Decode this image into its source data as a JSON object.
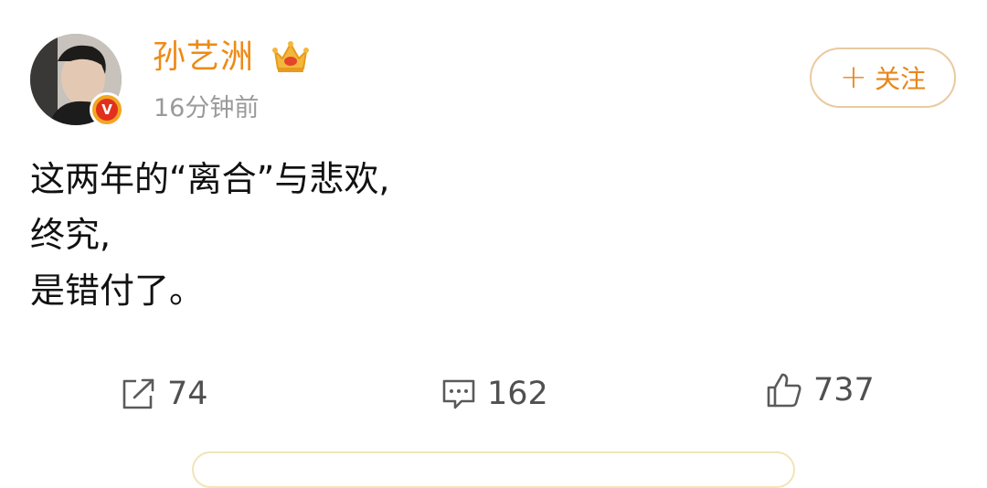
{
  "post": {
    "author": {
      "name": "孙艺洲",
      "avatar_icon": "avatar-photo",
      "verified_icon": "verified-v-icon",
      "verified_letter": "V",
      "rank_icon": "crown-icon"
    },
    "timestamp": "16分钟前",
    "follow_button": {
      "label": "关注",
      "icon": "plus-icon",
      "icon_glyph": "+"
    },
    "content_lines": [
      "这两年的“离合”与悲欢,",
      "终究,",
      "是错付了。"
    ],
    "actions": {
      "repost": {
        "icon": "share-icon",
        "count": "74"
      },
      "comment": {
        "icon": "comment-icon",
        "count": "162"
      },
      "like": {
        "icon": "thumbs-up-icon",
        "count": "737"
      }
    }
  },
  "colors": {
    "username": "#ee8a16",
    "follow_text": "#e8861a",
    "follow_border": "#e9ca9f",
    "timestamp": "#9a9a9a",
    "action_text": "#505050"
  }
}
